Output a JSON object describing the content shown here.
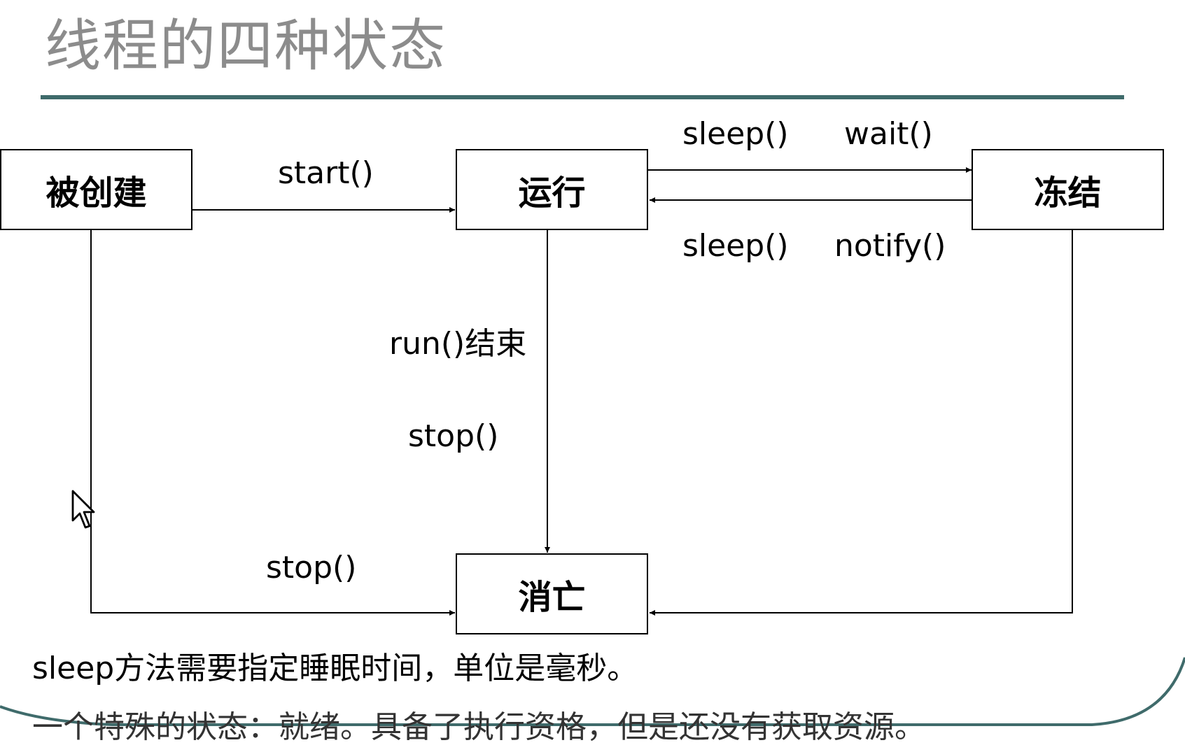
{
  "title": "线程的四种状态",
  "states": {
    "created": "被创建",
    "running": "运行",
    "frozen": "冻结",
    "dead": "消亡"
  },
  "transitions": {
    "start": "start()",
    "sleep_top": "sleep()",
    "wait": "wait()",
    "sleep_bottom": "sleep()",
    "notify": "notify()",
    "run_end": "run()结束",
    "stop_middle": "stop()",
    "stop_left": "stop()"
  },
  "notes": {
    "line1": "sleep方法需要指定睡眠时间，单位是毫秒。",
    "line2": "一个特殊的状态：就绪。具备了执行资格，但是还没有获取资源。"
  },
  "colors": {
    "title_text": "#8c8c8c",
    "title_rule": "#3f6b6b",
    "slide_frame": "#3f6b6b"
  },
  "icons": {
    "cursor": "mouse-pointer-icon"
  }
}
